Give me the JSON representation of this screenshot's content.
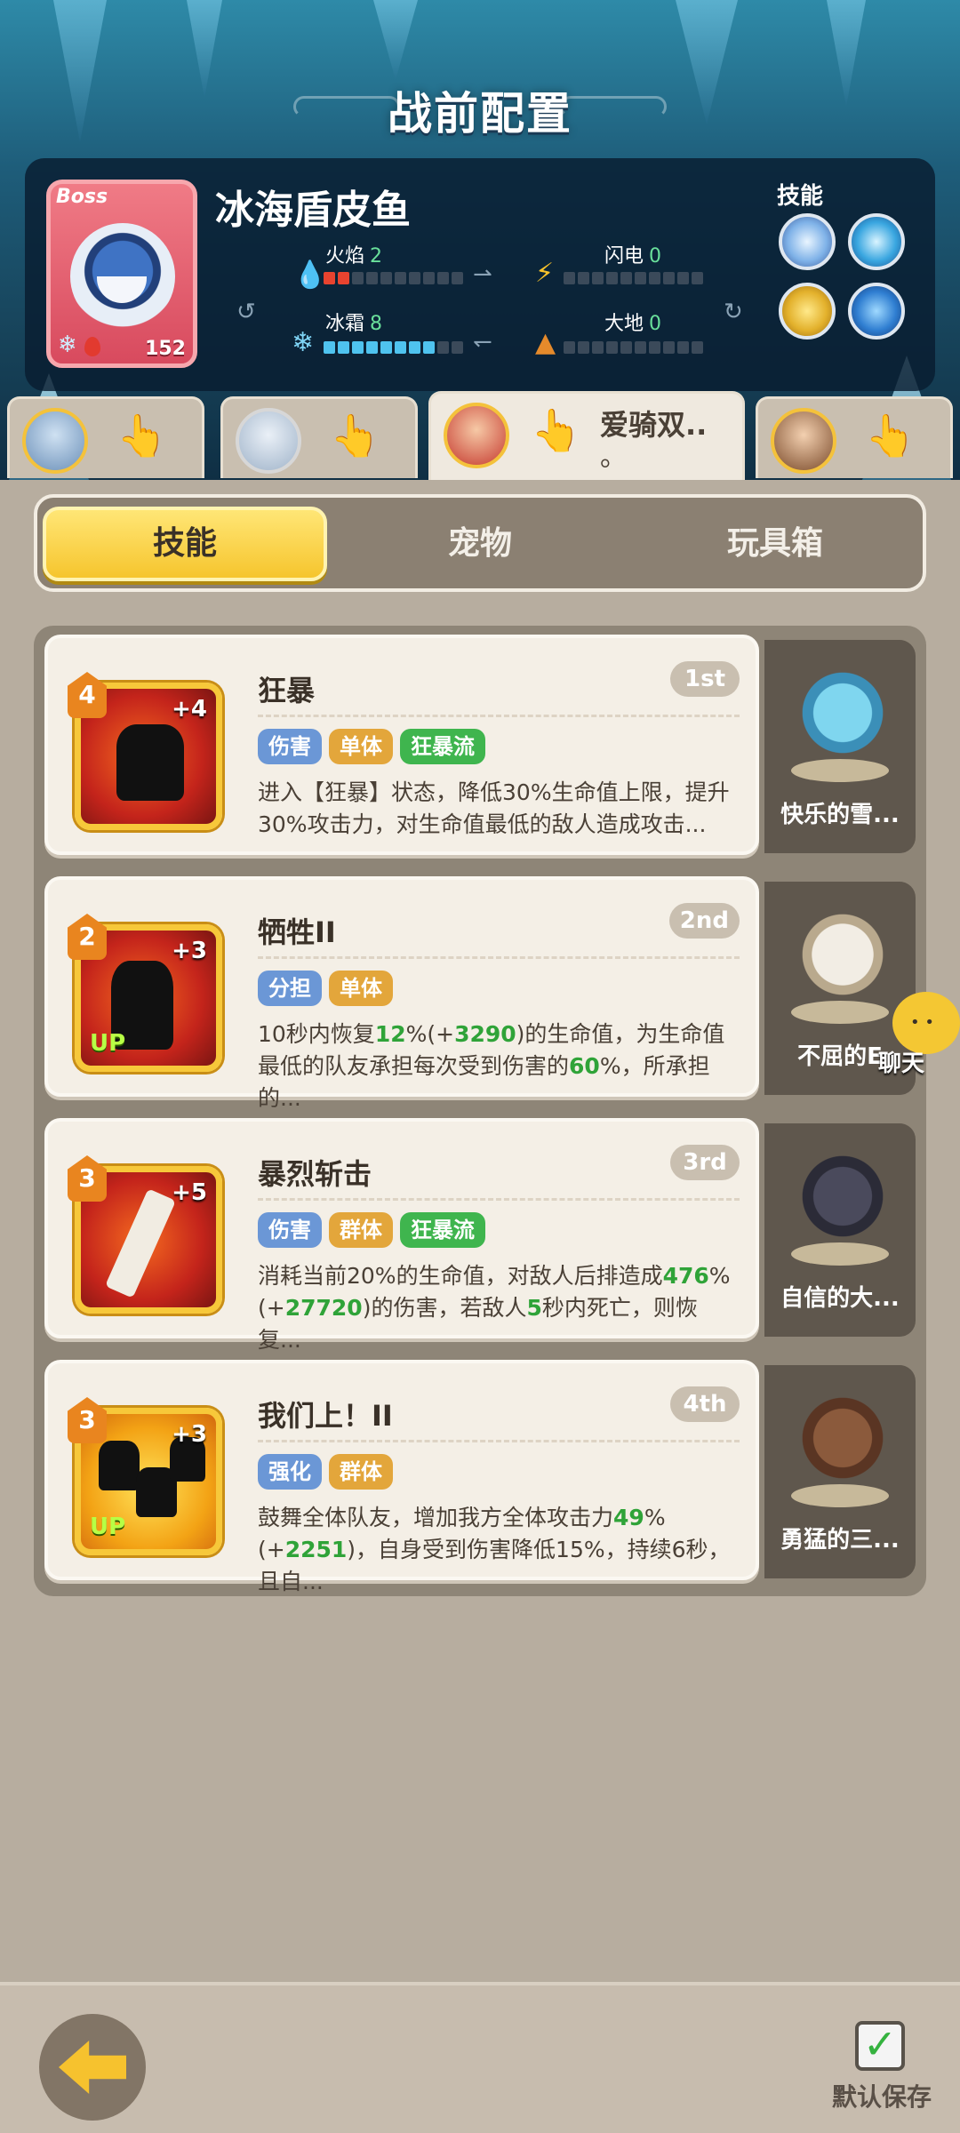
{
  "page": {
    "title": "战前配置"
  },
  "boss": {
    "badge": "Boss",
    "name": "冰海盾皮鱼",
    "level": "152",
    "elements": {
      "fire": {
        "label": "火焰",
        "value": "2",
        "fill": 2
      },
      "lightning": {
        "label": "闪电",
        "value": "0",
        "fill": 0
      },
      "frost": {
        "label": "冰霜",
        "value": "8",
        "fill": 8
      },
      "earth": {
        "label": "大地",
        "value": "0",
        "fill": 0
      }
    },
    "skills_label": "技能",
    "skill_icons": [
      "ice-crystal-icon",
      "frost-spike-icon",
      "golden-lion-icon",
      "blue-bird-icon"
    ]
  },
  "heroes": [
    {
      "name": "",
      "active": false
    },
    {
      "name": "",
      "active": false
    },
    {
      "name": "爱骑双..",
      "name_line2": "。",
      "active": true
    },
    {
      "name": "",
      "active": false
    }
  ],
  "tabs": {
    "skills": "技能",
    "pets": "宠物",
    "toybox": "玩具箱"
  },
  "skills": [
    {
      "name": "狂暴",
      "rank": "1st",
      "level": "4",
      "plus": "+4",
      "up": "",
      "tags": [
        "伤害",
        "单体",
        "狂暴流"
      ],
      "desc_parts": [
        "进入【狂暴】状态，降低30%生命值上限，提升30%攻击力，对生命值最低的敌人造成攻击..."
      ],
      "pet": "快乐的雪..."
    },
    {
      "name": "牺牲II",
      "rank": "2nd",
      "level": "2",
      "plus": "+3",
      "up": "UP",
      "tags": [
        "分担",
        "单体"
      ],
      "desc_parts": [
        "10秒内恢复",
        "12",
        "%(+",
        "3290",
        ")的生命值，为生命值最低的队友承担每次受到伤害的",
        "60",
        "%，所承担的..."
      ],
      "pet": "不屈的E"
    },
    {
      "name": "暴烈斩击",
      "rank": "3rd",
      "level": "3",
      "plus": "+5",
      "up": "",
      "tags": [
        "伤害",
        "群体",
        "狂暴流"
      ],
      "desc_parts": [
        "消耗当前20%的生命值，对敌人后排造成",
        "476",
        "%(+",
        "27720",
        ")的伤害，若敌人",
        "5",
        "秒内死亡，则恢复..."
      ],
      "pet": "自信的大..."
    },
    {
      "name": "我们上！II",
      "rank": "4th",
      "level": "3",
      "plus": "+3",
      "up": "UP",
      "tags": [
        "强化",
        "群体"
      ],
      "desc_parts": [
        "鼓舞全体队友，增加我方全体攻击力",
        "49",
        "%(+",
        "2251",
        ")，自身受到伤害降低15%，持续6秒，且自..."
      ],
      "pet": "勇猛的三..."
    }
  ],
  "chat": {
    "label": "聊天"
  },
  "footer": {
    "save_label": "默认保存",
    "save_checked": true
  },
  "colors": {
    "accent": "#f6c52d",
    "highlight": "#2fa338",
    "fire": "#e8432f",
    "frost": "#4fc3ef"
  }
}
